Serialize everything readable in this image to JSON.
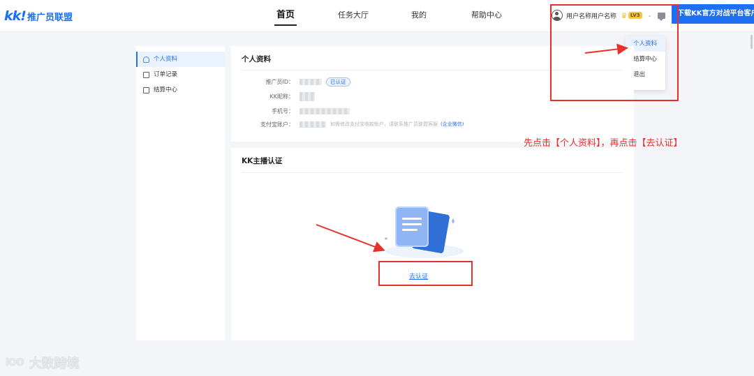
{
  "header": {
    "logo_mark": "kk!",
    "logo_text": "推广员联盟",
    "nav": [
      {
        "label": "首页",
        "active": true
      },
      {
        "label": "任务大厅",
        "active": false
      },
      {
        "label": "我的",
        "active": false
      },
      {
        "label": "帮助中心",
        "active": false
      }
    ],
    "user_name": "用户名称用户名称",
    "user_level": "LV3",
    "download_label": "下载KK官方对战平台客户端"
  },
  "user_menu": {
    "items": [
      {
        "label": "个人资料",
        "active": true
      },
      {
        "label": "结算中心",
        "active": false
      },
      {
        "label": "退出",
        "active": false
      }
    ]
  },
  "sidebar": {
    "items": [
      {
        "label": "个人资料",
        "icon": "person-icon",
        "active": true
      },
      {
        "label": "订单记录",
        "icon": "document-icon",
        "active": false
      },
      {
        "label": "结算中心",
        "icon": "wallet-icon",
        "active": false
      }
    ]
  },
  "profile": {
    "title": "个人资料",
    "fields": [
      {
        "label": "推广员ID：",
        "badge": "已认证"
      },
      {
        "label": "KK昵称："
      },
      {
        "label": "手机号："
      },
      {
        "label": "支付宝账户：",
        "hint": "如需修改支付宝收款账户，请联系推广员联盟客服",
        "link": "(企业微信)"
      }
    ]
  },
  "verification": {
    "title": "KK主播认证",
    "action_label": "去认证"
  },
  "annotation": {
    "text": "先点击【个人资料】，再点击【去认证】",
    "color": "#e8302a"
  },
  "watermark": {
    "logo": "lOO",
    "text": "大数跨境"
  },
  "colors": {
    "brand": "#1e6ff3",
    "page_bg": "#f3f5f8"
  }
}
